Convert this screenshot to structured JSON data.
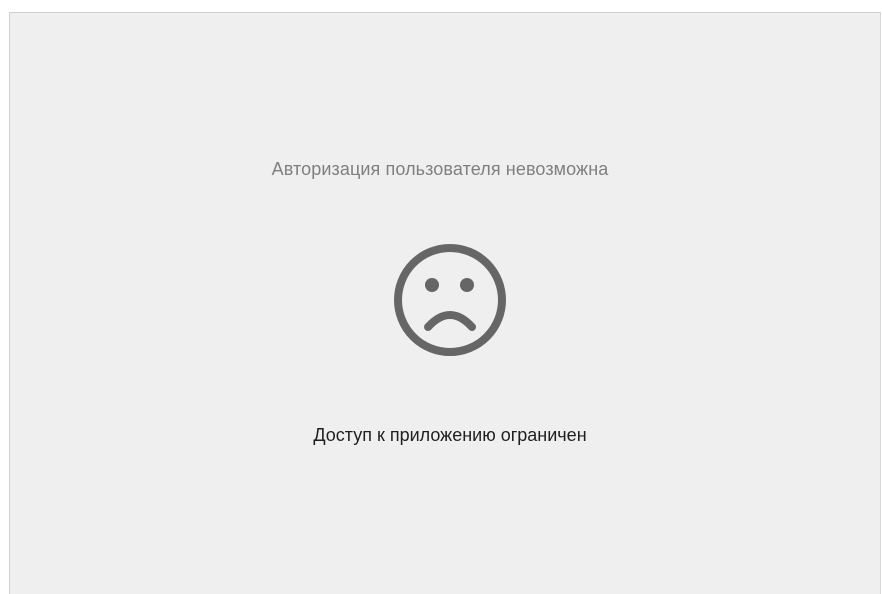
{
  "message": {
    "title": "Авторизация пользователя невозможна",
    "icon": "sad-face-icon",
    "subtitle": "Доступ к приложению ограничен"
  },
  "colors": {
    "background": "#efefef",
    "title_text": "#7f7f7f",
    "icon": "#666666",
    "subtitle_text": "#1f1f1f"
  }
}
